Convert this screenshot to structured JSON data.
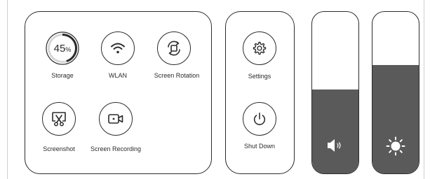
{
  "quick_settings": {
    "storage": {
      "percent_text": "45",
      "percent_sign": "%",
      "label": "Storage",
      "used_fraction": 0.45
    },
    "wlan": {
      "label": "WLAN",
      "icon": "wifi-icon"
    },
    "screen_rotation": {
      "label": "Screen Rotation",
      "icon": "screen-rotation-icon"
    },
    "screenshot": {
      "label": "Screenshot",
      "icon": "screenshot-scissors-icon"
    },
    "screen_recording": {
      "label": "Screen Recording",
      "icon": "video-camera-icon"
    }
  },
  "system": {
    "settings": {
      "label": "Settings",
      "icon": "gear-icon"
    },
    "shut_down": {
      "label": "Shut Down",
      "icon": "power-icon"
    }
  },
  "sliders": {
    "volume": {
      "level": 0.52,
      "icon": "speaker-icon"
    },
    "brightness": {
      "level": 0.67,
      "icon": "sun-icon"
    }
  },
  "colors": {
    "stroke": "#2b2b2b",
    "fill": "#5a5a5a",
    "storage_track": "#d6d6d6"
  }
}
